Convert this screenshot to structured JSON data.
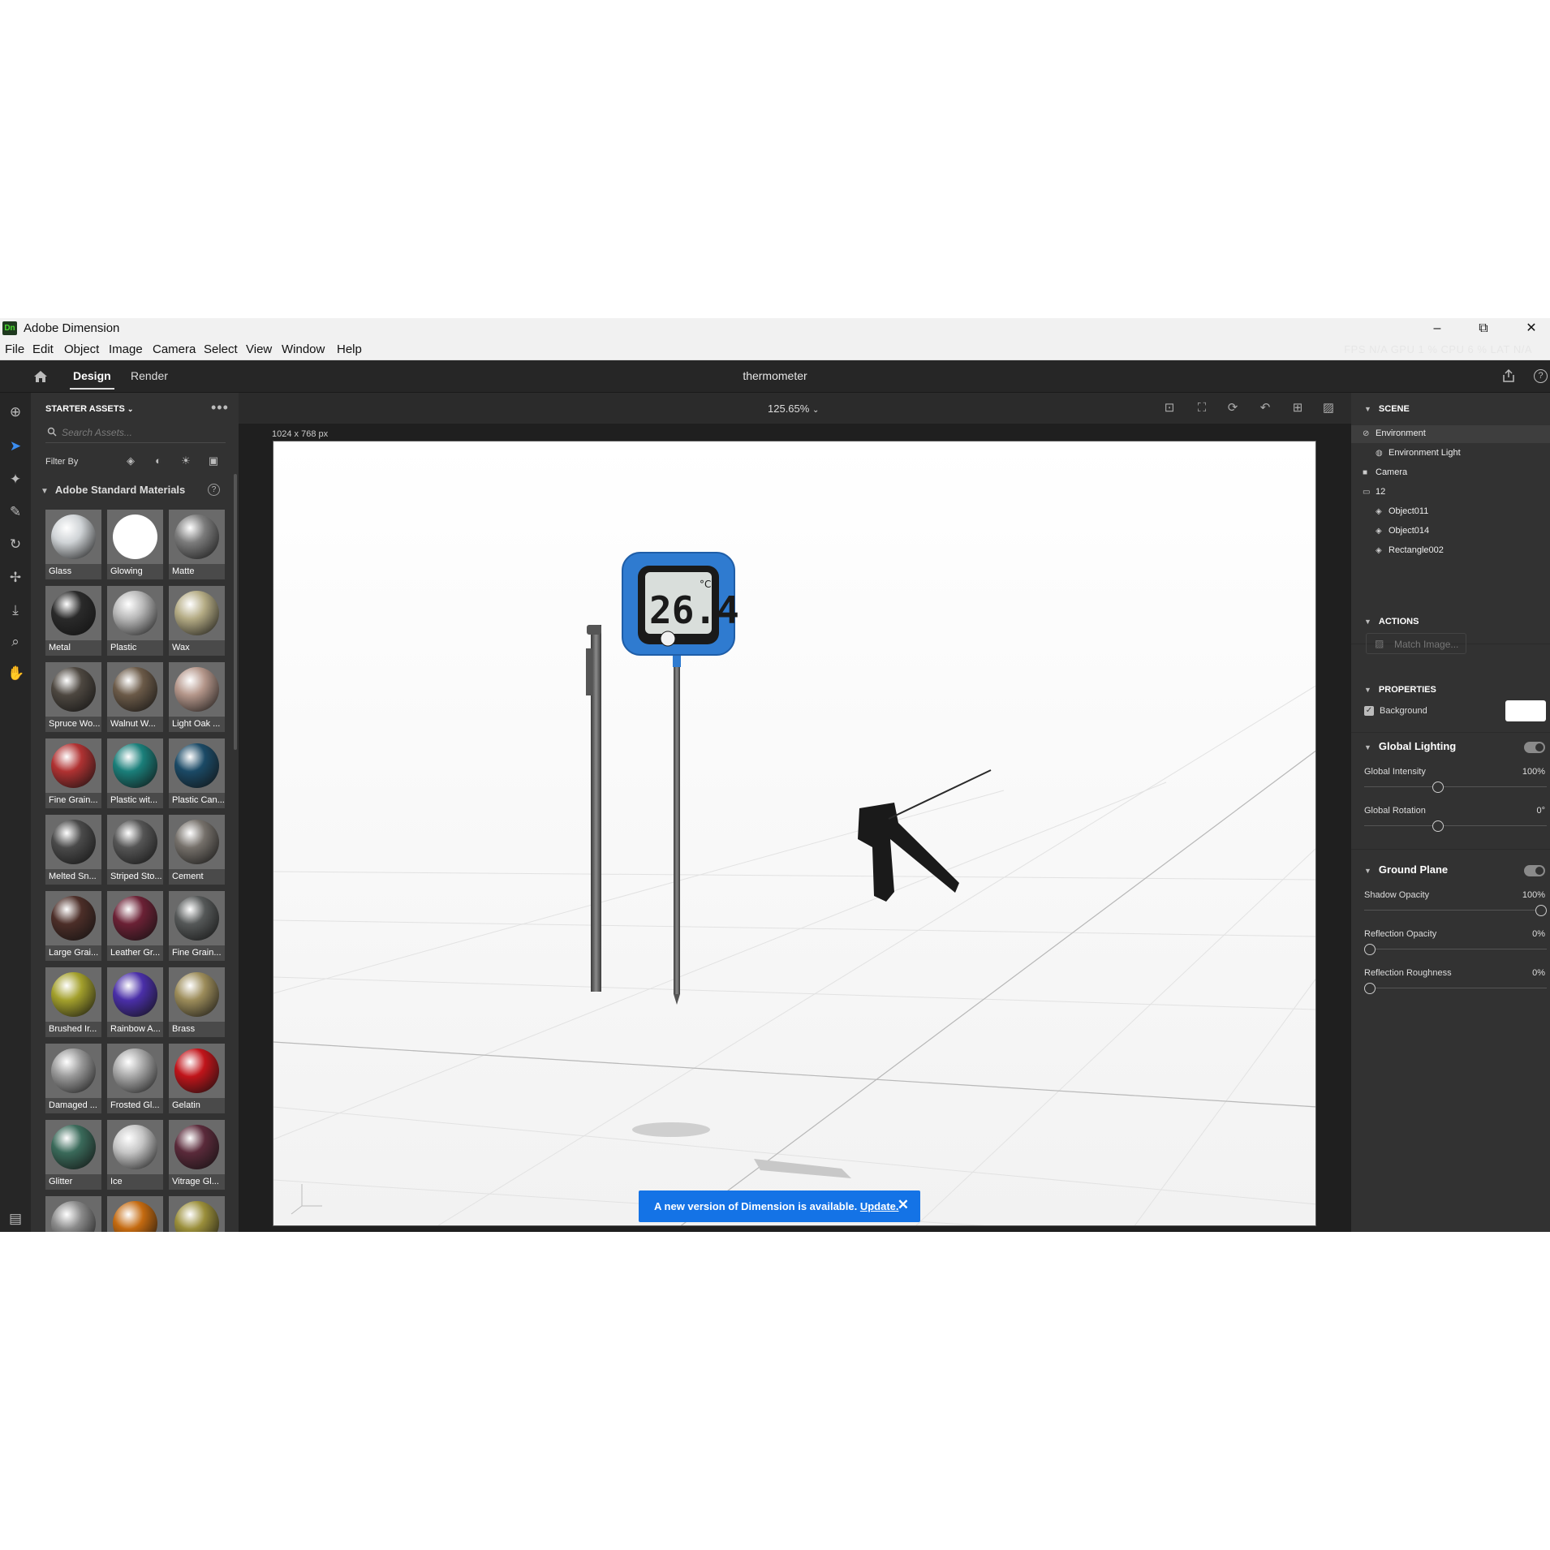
{
  "app": {
    "logo": "Dn",
    "title": "Adobe Dimension",
    "perf": "FPS  N/A  GPU  1 %  CPU  6 %  LAT  N/A"
  },
  "menu": [
    "File",
    "Edit",
    "Object",
    "Image",
    "Camera",
    "Select",
    "View",
    "Window",
    "Help"
  ],
  "header": {
    "tabs": [
      "Design",
      "Render"
    ],
    "active_tab": "Design",
    "document_title": "thermometer"
  },
  "assets": {
    "heading": "STARTER ASSETS",
    "search_placeholder": "Search Assets...",
    "filter_label": "Filter By",
    "section_title": "Adobe Standard Materials",
    "materials": [
      {
        "label": "Glass",
        "color": "#cfd3d6"
      },
      {
        "label": "Glowing",
        "color": "#ffffff"
      },
      {
        "label": "Matte",
        "color": "#7c7c7c"
      },
      {
        "label": "Metal",
        "color": "#2a2a2a"
      },
      {
        "label": "Plastic",
        "color": "#b8b8b8"
      },
      {
        "label": "Wax",
        "color": "#b4ab84"
      },
      {
        "label": "Spruce Wo...",
        "color": "#4d4740"
      },
      {
        "label": "Walnut W...",
        "color": "#6b5a48"
      },
      {
        "label": "Light Oak ...",
        "color": "#b4968a"
      },
      {
        "label": "Fine Grain...",
        "color": "#b03232"
      },
      {
        "label": "Plastic wit...",
        "color": "#1a7f7a"
      },
      {
        "label": "Plastic Can...",
        "color": "#1b4a66"
      },
      {
        "label": "Melted Sn...",
        "color": "#4a4a4a"
      },
      {
        "label": "Striped Sto...",
        "color": "#555555"
      },
      {
        "label": "Cement",
        "color": "#75706a"
      },
      {
        "label": "Large Grai...",
        "color": "#4c2e28"
      },
      {
        "label": "Leather Gr...",
        "color": "#6b2135"
      },
      {
        "label": "Fine Grain...",
        "color": "#555858"
      },
      {
        "label": "Brushed Ir...",
        "color": "#a3a02c"
      },
      {
        "label": "Rainbow A...",
        "color": "#4a2fa8"
      },
      {
        "label": "Brass",
        "color": "#9c8c5a"
      },
      {
        "label": "Damaged ...",
        "color": "#9a9a9a"
      },
      {
        "label": "Frosted Gl...",
        "color": "#a8a8a8"
      },
      {
        "label": "Gelatin",
        "color": "#c0141a"
      },
      {
        "label": "Glitter",
        "color": "#3a6a5a"
      },
      {
        "label": "Ice",
        "color": "#c5c5c5"
      },
      {
        "label": "Vitrage Gl...",
        "color": "#5a2a3a"
      },
      {
        "label": "",
        "color": "#8a8a8a"
      },
      {
        "label": "",
        "color": "#c46a10"
      },
      {
        "label": "",
        "color": "#9a8e3a"
      }
    ]
  },
  "canvas": {
    "zoom": "125.65%",
    "size": "1024 x 768 px"
  },
  "toast": {
    "message": "A new version of Dimension is available.",
    "link": "Update."
  },
  "scene": {
    "heading": "SCENE",
    "items": [
      {
        "label": "Environment",
        "icon": "globe-icon",
        "glyph": "⊘"
      },
      {
        "label": "Environment Light",
        "icon": "light-icon",
        "glyph": "◍"
      },
      {
        "label": "Camera",
        "icon": "camera-icon",
        "glyph": "■"
      },
      {
        "label": "12",
        "icon": "folder-icon",
        "glyph": "▭"
      },
      {
        "label": "Object011",
        "icon": "object-icon",
        "glyph": "◈"
      },
      {
        "label": "Object014",
        "icon": "object-icon",
        "glyph": "◈"
      },
      {
        "label": "Rectangle002",
        "icon": "object-icon",
        "glyph": "◈"
      }
    ]
  },
  "actions": {
    "heading": "ACTIONS",
    "match_image": "Match Image..."
  },
  "properties": {
    "heading": "PROPERTIES",
    "background_label": "Background",
    "background_checked": true,
    "background_color": "#ffffff",
    "global_lighting": {
      "title": "Global Lighting",
      "enabled": true,
      "intensity_label": "Global Intensity",
      "intensity_value": "100%",
      "intensity_level": 0.4,
      "rotation_label": "Global Rotation",
      "rotation_value": "0°",
      "rotation_level": 0.4
    },
    "ground_plane": {
      "title": "Ground Plane",
      "enabled": true,
      "shadow_label": "Shadow Opacity",
      "shadow_value": "100%",
      "shadow_level": 1.0,
      "reflection_label": "Reflection Opacity",
      "reflection_value": "0%",
      "reflection_level": 0.0,
      "roughness_label": "Reflection Roughness",
      "roughness_value": "0%",
      "roughness_level": 0.0
    }
  },
  "colors": {
    "accent": "#1473e6",
    "panel": "#323232",
    "header": "#262626",
    "thermometer_blue": "#2f7bd0"
  }
}
